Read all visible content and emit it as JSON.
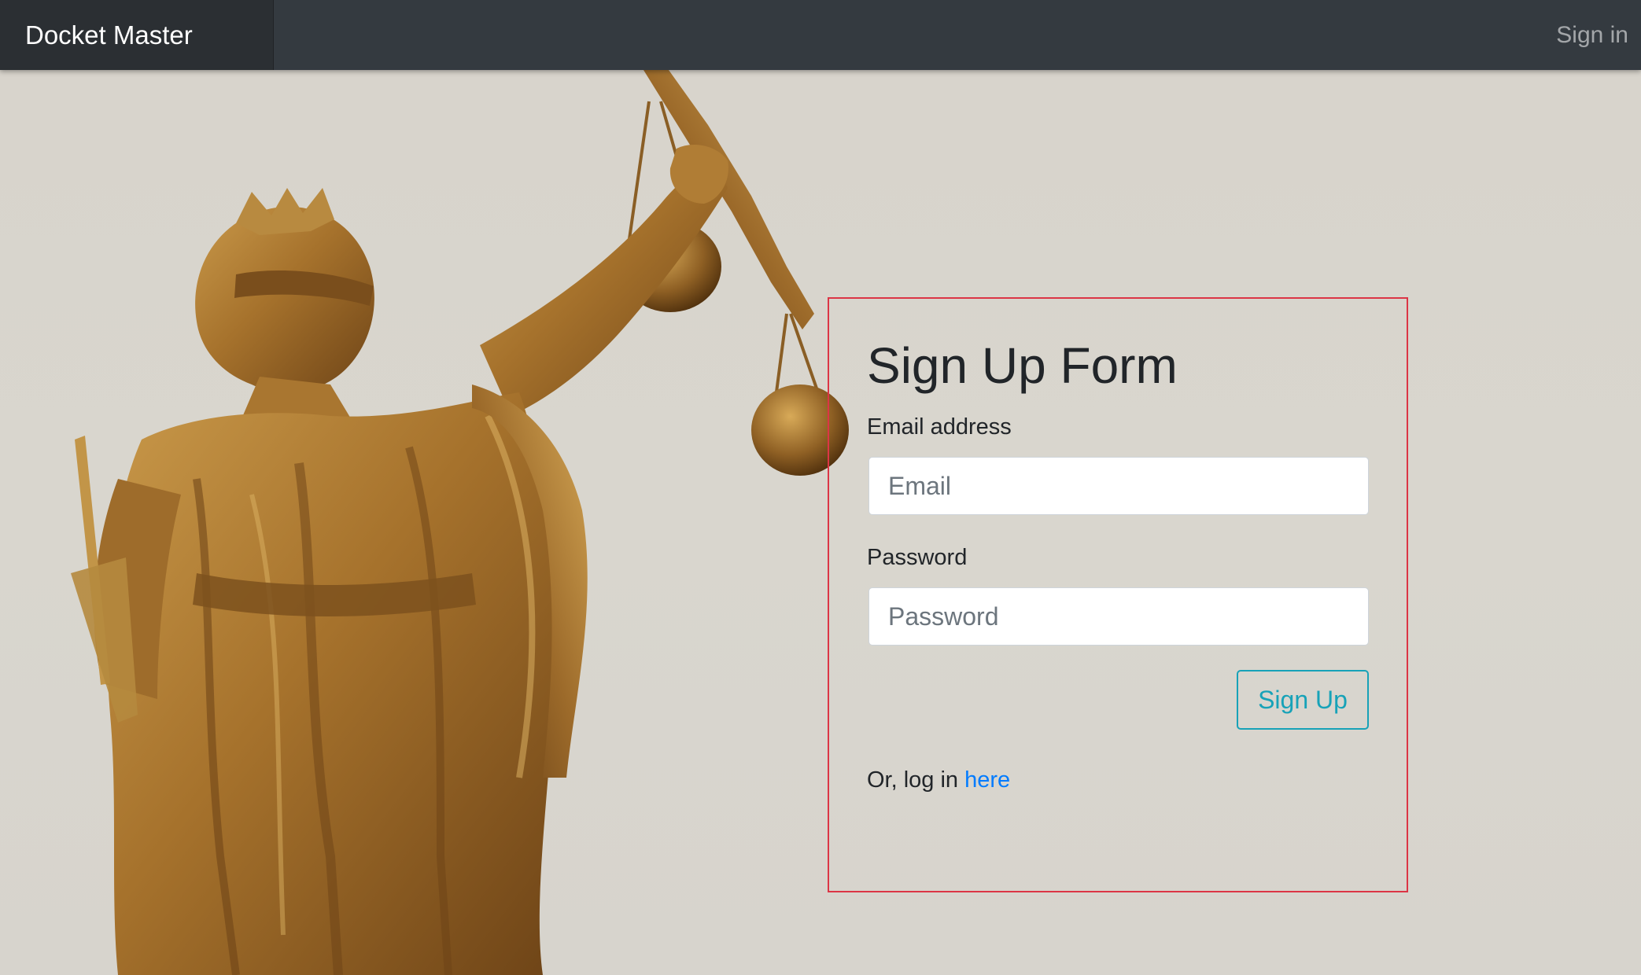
{
  "navbar": {
    "brand": "Docket Master",
    "signin_label": "Sign in"
  },
  "form": {
    "title": "Sign Up Form",
    "email_label": "Email address",
    "email_placeholder": "Email",
    "password_label": "Password",
    "password_placeholder": "Password",
    "submit_label": "Sign Up",
    "login_prefix": "Or, log in ",
    "login_link": "here"
  },
  "colors": {
    "navbar": "#343a40",
    "brand_bg": "#2b2f33",
    "form_border": "#dc3545",
    "button": "#17a2b8",
    "link": "#007bff"
  }
}
